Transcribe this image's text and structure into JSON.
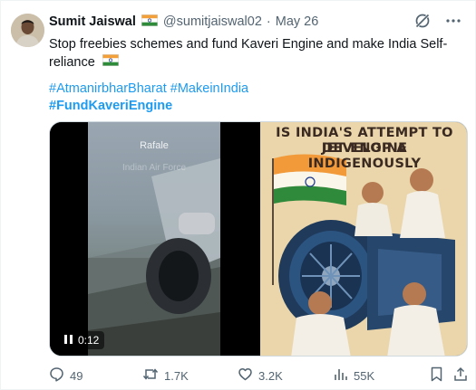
{
  "author": {
    "name": "Sumit Jaiswal",
    "handle": "@sumitjaiswal02",
    "separator": "·",
    "date": "May 26"
  },
  "tweet": {
    "text": "Stop freebies schemes and fund Kaveri Engine and make India Self-reliance",
    "hashtags_line1": "#AtmanirbharBharat #MakeinIndia",
    "hashtags_line2": "#FundKaveriEngine"
  },
  "media": {
    "video_label_1": "Rafale",
    "video_label_2": "Indian Air Force",
    "video_time": "0:12",
    "poster_title_line1": "IS INDIA'S ATTEMPT TO DEVELOP A",
    "poster_title_line2": "JET ENGINE INDIGENOUSLY"
  },
  "actions": {
    "replies": "49",
    "reposts": "1.7K",
    "likes": "3.2K",
    "views": "55K"
  },
  "icons": {
    "header": [
      "grok-icon",
      "more-icon"
    ],
    "footer": [
      "reply-icon",
      "repost-icon",
      "like-icon",
      "views-icon",
      "bookmark-icon",
      "share-icon"
    ]
  },
  "colors": {
    "link": "#1d9bf0",
    "secondary_text": "#536471",
    "primary_text": "#0f1419"
  }
}
